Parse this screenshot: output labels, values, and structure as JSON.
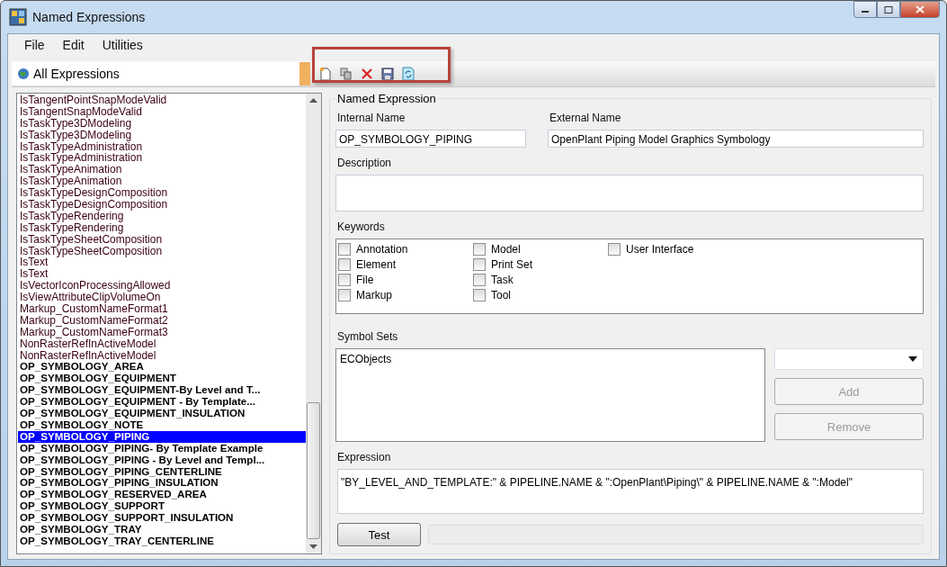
{
  "window": {
    "title": "Named Expressions"
  },
  "menu": [
    "File",
    "Edit",
    "Utilities"
  ],
  "filter": {
    "value": "All Expressions"
  },
  "expressions": [
    {
      "name": "IsTangentPointSnapModeValid",
      "bold": false,
      "selected": false
    },
    {
      "name": "IsTangentSnapModeValid",
      "bold": false,
      "selected": false
    },
    {
      "name": "IsTaskType3DModeling",
      "bold": false,
      "selected": false
    },
    {
      "name": "IsTaskType3DModeling",
      "bold": false,
      "selected": false
    },
    {
      "name": "IsTaskTypeAdministration",
      "bold": false,
      "selected": false
    },
    {
      "name": "IsTaskTypeAdministration",
      "bold": false,
      "selected": false
    },
    {
      "name": "IsTaskTypeAnimation",
      "bold": false,
      "selected": false
    },
    {
      "name": "IsTaskTypeAnimation",
      "bold": false,
      "selected": false
    },
    {
      "name": "IsTaskTypeDesignComposition",
      "bold": false,
      "selected": false
    },
    {
      "name": "IsTaskTypeDesignComposition",
      "bold": false,
      "selected": false
    },
    {
      "name": "IsTaskTypeRendering",
      "bold": false,
      "selected": false
    },
    {
      "name": "IsTaskTypeRendering",
      "bold": false,
      "selected": false
    },
    {
      "name": "IsTaskTypeSheetComposition",
      "bold": false,
      "selected": false
    },
    {
      "name": "IsTaskTypeSheetComposition",
      "bold": false,
      "selected": false
    },
    {
      "name": "IsText",
      "bold": false,
      "selected": false
    },
    {
      "name": "IsText",
      "bold": false,
      "selected": false
    },
    {
      "name": "IsVectorIconProcessingAllowed",
      "bold": false,
      "selected": false
    },
    {
      "name": "IsViewAttributeClipVolumeOn",
      "bold": false,
      "selected": false
    },
    {
      "name": "Markup_CustomNameFormat1",
      "bold": false,
      "selected": false
    },
    {
      "name": "Markup_CustomNameFormat2",
      "bold": false,
      "selected": false
    },
    {
      "name": "Markup_CustomNameFormat3",
      "bold": false,
      "selected": false
    },
    {
      "name": "NonRasterRefInActiveModel",
      "bold": false,
      "selected": false
    },
    {
      "name": "NonRasterRefInActiveModel",
      "bold": false,
      "selected": false
    },
    {
      "name": "OP_SYMBOLOGY_AREA",
      "bold": true,
      "selected": false
    },
    {
      "name": "OP_SYMBOLOGY_EQUIPMENT",
      "bold": true,
      "selected": false
    },
    {
      "name": "OP_SYMBOLOGY_EQUIPMENT-By Level and T...",
      "bold": true,
      "selected": false
    },
    {
      "name": "OP_SYMBOLOGY_EQUIPMENT - By Template...",
      "bold": true,
      "selected": false
    },
    {
      "name": "OP_SYMBOLOGY_EQUIPMENT_INSULATION",
      "bold": true,
      "selected": false
    },
    {
      "name": "OP_SYMBOLOGY_NOTE",
      "bold": true,
      "selected": false
    },
    {
      "name": "OP_SYMBOLOGY_PIPING",
      "bold": true,
      "selected": true
    },
    {
      "name": "OP_SYMBOLOGY_PIPING- By Template Example",
      "bold": true,
      "selected": false
    },
    {
      "name": "OP_SYMBOLOGY_PIPING - By Level and Templ...",
      "bold": true,
      "selected": false
    },
    {
      "name": "OP_SYMBOLOGY_PIPING_CENTERLINE",
      "bold": true,
      "selected": false
    },
    {
      "name": "OP_SYMBOLOGY_PIPING_INSULATION",
      "bold": true,
      "selected": false
    },
    {
      "name": "OP_SYMBOLOGY_RESERVED_AREA",
      "bold": true,
      "selected": false
    },
    {
      "name": "OP_SYMBOLOGY_SUPPORT",
      "bold": true,
      "selected": false
    },
    {
      "name": "OP_SYMBOLOGY_SUPPORT_INSULATION",
      "bold": true,
      "selected": false
    },
    {
      "name": "OP_SYMBOLOGY_TRAY",
      "bold": true,
      "selected": false
    },
    {
      "name": "OP_SYMBOLOGY_TRAY_CENTERLINE",
      "bold": true,
      "selected": false
    }
  ],
  "details": {
    "group_title": "Named Expression",
    "internal_name": {
      "label": "Internal Name",
      "value": "OP_SYMBOLOGY_PIPING"
    },
    "external_name": {
      "label": "External Name",
      "value": "OpenPlant Piping Model Graphics Symbology"
    },
    "description": {
      "label": "Description"
    },
    "keywords": {
      "label": "Keywords",
      "items": [
        {
          "label": "Annotation",
          "checked": false
        },
        {
          "label": "Element",
          "checked": false
        },
        {
          "label": "File",
          "checked": false
        },
        {
          "label": "Markup",
          "checked": false
        },
        {
          "label": "Model",
          "checked": false
        },
        {
          "label": "Print Set",
          "checked": false
        },
        {
          "label": "Task",
          "checked": false
        },
        {
          "label": "Tool",
          "checked": false
        },
        {
          "label": "User Interface",
          "checked": false
        }
      ]
    },
    "symbol_sets": {
      "label": "Symbol Sets",
      "items": [
        "ECObjects"
      ],
      "add": "Add",
      "remove": "Remove"
    },
    "expression": {
      "label": "Expression",
      "value": "\"BY_LEVEL_AND_TEMPLATE:\" & PIPELINE.NAME & \":OpenPlant\\Piping\\\" & PIPELINE.NAME & \":Model\""
    },
    "test_button": "Test"
  }
}
